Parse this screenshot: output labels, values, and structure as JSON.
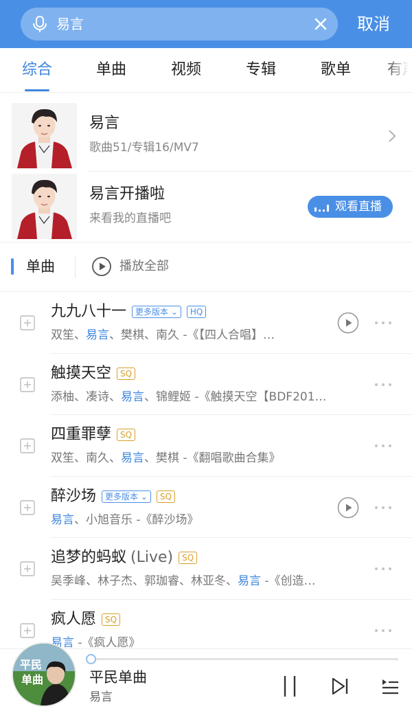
{
  "search": {
    "query": "易言",
    "cancel_label": "取消"
  },
  "tabs": [
    {
      "label": "综合",
      "active": true
    },
    {
      "label": "单曲",
      "active": false
    },
    {
      "label": "视频",
      "active": false
    },
    {
      "label": "专辑",
      "active": false
    },
    {
      "label": "歌单",
      "active": false
    },
    {
      "label": "有声",
      "active": false
    }
  ],
  "artist_card": {
    "name": "易言",
    "stats": "歌曲51/专辑16/MV7"
  },
  "live_card": {
    "title": "易言开播啦",
    "subtitle": "来看我的直播吧",
    "button_label": "观看直播"
  },
  "section": {
    "title": "单曲",
    "play_all_label": "播放全部"
  },
  "songs": [
    {
      "title": "九九八十一",
      "version_tag": "更多版本",
      "quality": "HQ",
      "has_mv": true,
      "desc_pre": "双笙、",
      "desc_hl": "易言",
      "desc_post": "、樊棋、南久 -《【四人合唱】…"
    },
    {
      "title": "触摸天空",
      "version_tag": "",
      "quality": "SQ",
      "has_mv": false,
      "desc_pre": "添柚、凑诗、",
      "desc_hl": "易言",
      "desc_post": "、锦鲤姬 -《触摸天空【BDF201…"
    },
    {
      "title": "四重罪孽",
      "version_tag": "",
      "quality": "SQ",
      "has_mv": false,
      "desc_pre": "双笙、南久、",
      "desc_hl": "易言",
      "desc_post": "、樊棋 -《翻唱歌曲合集》"
    },
    {
      "title": "醉沙场",
      "version_tag": "更多版本",
      "quality": "SQ",
      "has_mv": true,
      "desc_pre": "",
      "desc_hl": "易言",
      "desc_post": "、小旭音乐 -《醉沙场》"
    },
    {
      "title": "追梦的蚂蚁",
      "subtitle": "(Live)",
      "version_tag": "",
      "quality": "SQ",
      "has_mv": false,
      "desc_pre": "吴季峰、林子杰、郭珈睿、林亚冬、",
      "desc_hl": "易言",
      "desc_post": " -《创造…"
    },
    {
      "title": "疯人愿",
      "version_tag": "",
      "quality": "SQ",
      "has_mv": false,
      "desc_pre": "",
      "desc_hl": "易言",
      "desc_post": " -《疯人愿》"
    }
  ],
  "player": {
    "title": "平民单曲",
    "artist": "易言",
    "cover_text": "平民单曲",
    "progress": 0.0
  },
  "colors": {
    "accent": "#4a8fe6",
    "sq_tag": "#d7a02a"
  },
  "icons": [
    "mic-icon",
    "clear-icon",
    "chevron-right-icon",
    "live-bars-icon",
    "play-circle-icon",
    "add-icon",
    "mv-play-icon",
    "more-icon",
    "pause-icon",
    "next-icon",
    "playlist-icon"
  ]
}
